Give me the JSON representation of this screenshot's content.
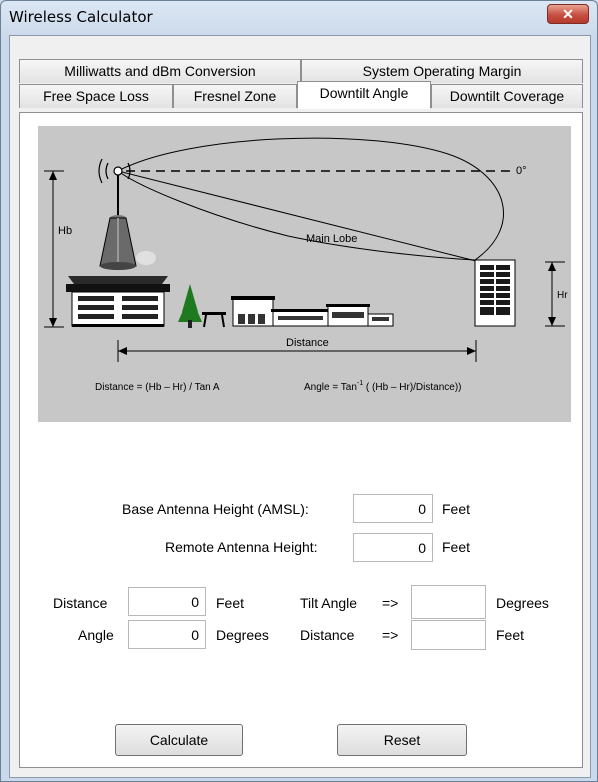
{
  "window": {
    "title": "Wireless Calculator",
    "close_glyph": "✕"
  },
  "tabs": {
    "row1": [
      "Milliwatts and dBm Conversion",
      "System Operating Margin"
    ],
    "row2": [
      "Free Space Loss",
      "Fresnel Zone",
      "Downtilt Angle",
      "Downtilt Coverage"
    ],
    "active": "Downtilt Angle"
  },
  "diagram": {
    "zero_degree": "0°",
    "hb": "Hb",
    "hr": "Hr",
    "main_lobe": "Main Lobe",
    "distance": "Distance",
    "formula_distance": "Distance = (Hb – Hr) / Tan A",
    "formula_angle_prefix": "Angle = Tan",
    "formula_angle_sup": "-1",
    "formula_angle_suffix": " ( (Hb – Hr)/Distance))"
  },
  "form": {
    "base_height": {
      "label": "Base Antenna Height (AMSL):",
      "value": "0",
      "unit": "Feet"
    },
    "remote_height": {
      "label": "Remote Antenna Height:",
      "value": "0",
      "unit": "Feet"
    },
    "distance_in": {
      "label": "Distance",
      "value": "0",
      "unit": "Feet"
    },
    "angle_in": {
      "label": "Angle",
      "value": "0",
      "unit": "Degrees"
    },
    "tilt_out": {
      "label": "Tilt Angle",
      "arrow": "=>",
      "value": "",
      "unit": "Degrees"
    },
    "distance_out": {
      "label": "Distance",
      "arrow": "=>",
      "value": "",
      "unit": "Feet"
    }
  },
  "buttons": {
    "calculate": "Calculate",
    "reset": "Reset"
  },
  "icons": [
    "close-icon",
    "antenna-icon",
    "tower-icon",
    "tree-icon",
    "bench-icon",
    "building-icon"
  ]
}
